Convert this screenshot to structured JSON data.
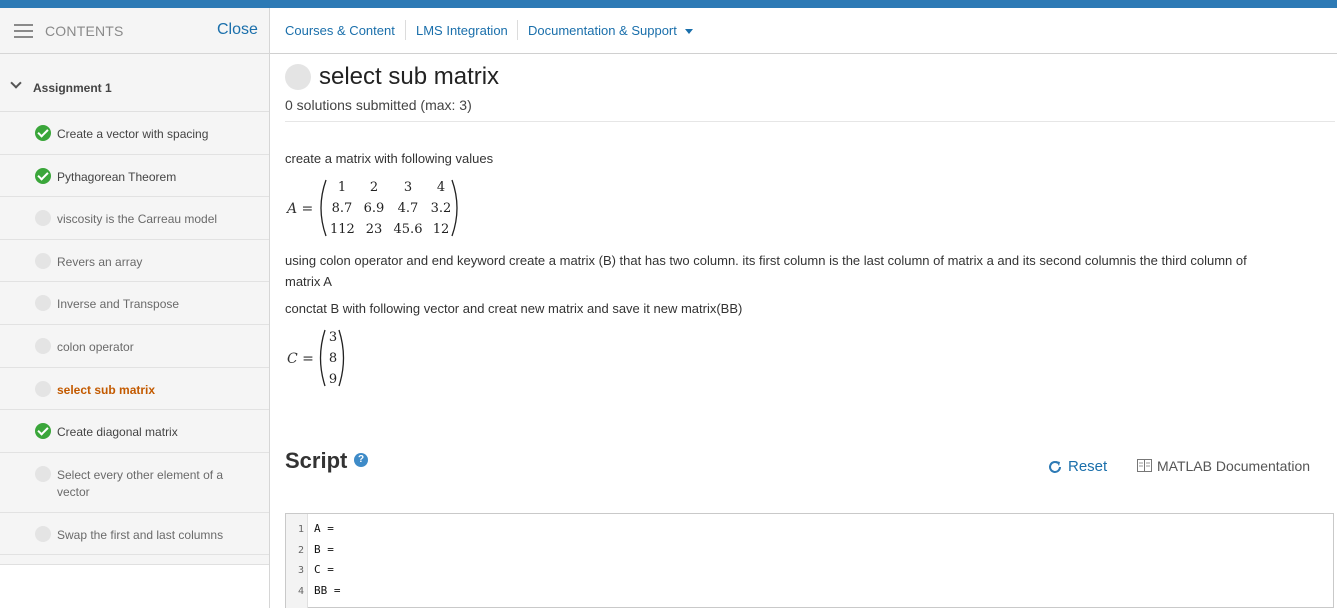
{
  "sidebar": {
    "title": "CONTENTS",
    "close_label": "Close",
    "section_label": "Assignment 1",
    "items": [
      {
        "label": "Create a vector with spacing",
        "status": "complete"
      },
      {
        "label": "Pythagorean Theorem",
        "status": "complete"
      },
      {
        "label": "viscosity is the Carreau model",
        "status": "not-started"
      },
      {
        "label": "Revers an array",
        "status": "not-started"
      },
      {
        "label": "Inverse and Transpose",
        "status": "not-started"
      },
      {
        "label": "colon operator",
        "status": "not-started"
      },
      {
        "label": "select sub matrix",
        "status": "current"
      },
      {
        "label": "Create diagonal matrix",
        "status": "complete"
      },
      {
        "label": "Select every other element of a vector",
        "status": "not-started"
      },
      {
        "label": "Swap the first and last columns",
        "status": "not-started"
      }
    ]
  },
  "nav": {
    "courses": "Courses & Content",
    "lms": "LMS Integration",
    "docs": "Documentation & Support"
  },
  "problem": {
    "title": "select sub matrix",
    "submissions": "0 solutions submitted (max: 3)",
    "p1": "create a matrix with following values",
    "p2": "using colon operator and end keyword create a matrix (B) that has two column. its first column is the  last column of matrix a and its second columnis the third column of matrix A",
    "p3": "conctat B with following vector and creat new matrix and save it new matrix(BB)",
    "matrix_a": {
      "label": "A =",
      "rows": [
        [
          "1",
          "2",
          "3",
          "4"
        ],
        [
          "8.7",
          "6.9",
          "4.7",
          "3.2"
        ],
        [
          "112",
          "23",
          "45.6",
          "12"
        ]
      ]
    },
    "matrix_c": {
      "label": "C =",
      "rows": [
        [
          "3"
        ],
        [
          "8"
        ],
        [
          "9"
        ]
      ]
    }
  },
  "script": {
    "heading": "Script",
    "help": "?",
    "reset": "Reset",
    "doc_link": "MATLAB Documentation",
    "lines": [
      "A =",
      "B =",
      "C =",
      "BB ="
    ]
  },
  "colors": {
    "accent": "#2d7ab5",
    "link": "#1a6fab",
    "complete": "#3aa63a",
    "current": "#c35a00"
  }
}
